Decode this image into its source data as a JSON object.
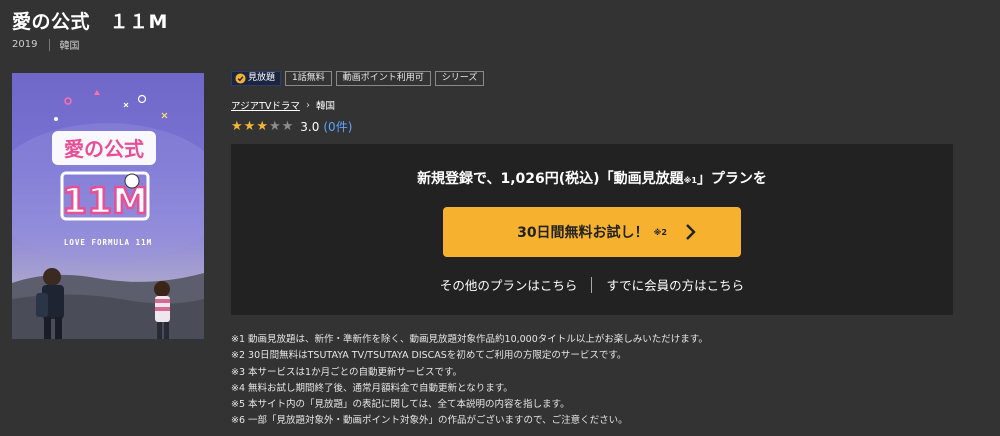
{
  "title": "愛の公式　１１M",
  "meta": {
    "year": "2019",
    "country": "韓国"
  },
  "poster": {
    "logo_text": "愛の公式",
    "logo_number": "11M",
    "subtitle": "LOVE FORMULA 11M"
  },
  "tags": [
    "見放題",
    "1話無料",
    "動画ポイント利用可",
    "シリーズ"
  ],
  "breadcrumb": {
    "category": "アジアTVドラマ",
    "sub": "韓国"
  },
  "rating": {
    "score": "3.0",
    "count": "(0件)",
    "stars_filled": 3,
    "stars_total": 5
  },
  "promo": {
    "text_before": "新規登録で、1,026円(税込)「動画見放題",
    "note": "※1",
    "text_after": "」プランを"
  },
  "cta": {
    "label": "30日間無料お試し！",
    "note": "※2"
  },
  "links": {
    "other_plans": "その他のプランはこちら",
    "members": "すでに会員の方はこちら"
  },
  "notes": [
    "※1 動画見放題は、新作・準新作を除く、動画見放題対象作品約10,000タイトル以上がお楽しみいただけます。",
    "※2 30日間無料はTSUTAYA TV/TSUTAYA DISCASを初めてご利用の方限定のサービスです。",
    "※3 本サービスは1か月ごとの自動更新サービスです。",
    "※4 無料お試し期間終了後、通常月額料金で自動更新となります。",
    "※5 本サイト内の「見放題」の表記に関しては、全て本説明の内容を指します。",
    "※6 一部「見放題対象外・動画ポイント対象外」の作品がございますので、ご注意ください。"
  ],
  "colors": {
    "accent": "#f6b22e",
    "background": "#333333",
    "panel": "#222222",
    "link": "#5ea2ff",
    "star": "#f3b23a"
  }
}
